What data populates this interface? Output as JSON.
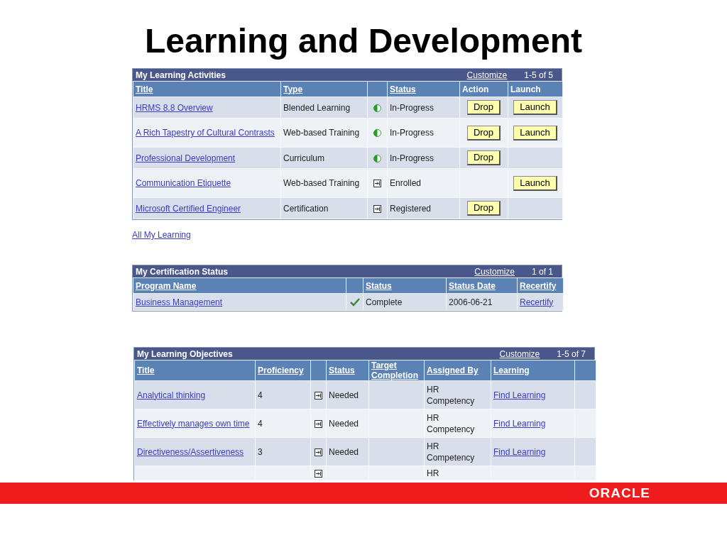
{
  "slide_title": "Learning and Development",
  "activities": {
    "title": "My Learning Activities",
    "customize": "Customize",
    "count": "1-5 of 5",
    "columns": [
      {
        "label": "Title",
        "link": true
      },
      {
        "label": "Type",
        "link": true
      },
      null,
      {
        "label": "Status",
        "link": true
      },
      {
        "label": "Action",
        "link": false
      },
      {
        "label": "Launch",
        "link": false
      }
    ],
    "rows": [
      {
        "title": "HRMS 8.8 Overview",
        "type": "Blended Learning",
        "kind": "in-progress",
        "status": "In-Progress",
        "action": "Drop",
        "launch": "Launch"
      },
      {
        "title": "A Rich Tapestry of Cultural Contrasts",
        "type": "Web-based Training",
        "kind": "in-progress",
        "status": "In-Progress",
        "action": "Drop",
        "launch": "Launch"
      },
      {
        "title": "Professional Development",
        "type": "Curriculum",
        "kind": "in-progress",
        "status": "In-Progress",
        "action": "Drop"
      },
      {
        "title": "Communication Etiquette",
        "type": "Web-based Training",
        "kind": "enrolled",
        "status": "Enrolled",
        "launch": "Launch"
      },
      {
        "title": "Microsoft Certified Engineer",
        "type": "Certification",
        "kind": "enrolled",
        "status": "Registered",
        "action": "Drop"
      }
    ],
    "footer_link": "All My Learning"
  },
  "certification": {
    "title": "My Certification Status",
    "customize": "Customize",
    "count": "1 of 1",
    "columns": [
      {
        "label": "Program Name",
        "link": true
      },
      null,
      {
        "label": "Status",
        "link": true
      },
      {
        "label": "Status Date",
        "link": true
      },
      {
        "label": "Recertify",
        "link": true
      }
    ],
    "rows": [
      {
        "program": "Business Management",
        "kind": "complete",
        "status": "Complete",
        "date": "2006-06-21",
        "recertify": "Recertify"
      }
    ]
  },
  "objectives": {
    "title": "My Learning Objectives",
    "customize": "Customize",
    "count": "1-5 of 7",
    "columns": [
      {
        "label": "Title",
        "link": true
      },
      {
        "label": "Proficiency",
        "link": true
      },
      null,
      {
        "label": "Status",
        "link": true
      },
      {
        "label": "Target Completion",
        "link": true
      },
      {
        "label": "Assigned By",
        "link": true
      },
      {
        "label": "Learning",
        "link": true
      },
      null
    ],
    "rows": [
      {
        "title": "Analytical thinking",
        "proficiency": "4",
        "kind": "enrolled",
        "status": "Needed",
        "assigned": "HR Competency",
        "learning": "Find Learning"
      },
      {
        "title": "Effectively manages own time",
        "proficiency": "4",
        "kind": "enrolled",
        "status": "Needed",
        "assigned": "HR Competency",
        "learning": "Find Learning"
      },
      {
        "title": "Directiveness/Assertiveness",
        "proficiency": "3",
        "kind": "enrolled",
        "status": "Needed",
        "assigned": "HR Competency",
        "learning": "Find Learning"
      },
      {
        "kind": "enrolled",
        "assigned": "HR"
      }
    ]
  },
  "logo": "ORACLE"
}
